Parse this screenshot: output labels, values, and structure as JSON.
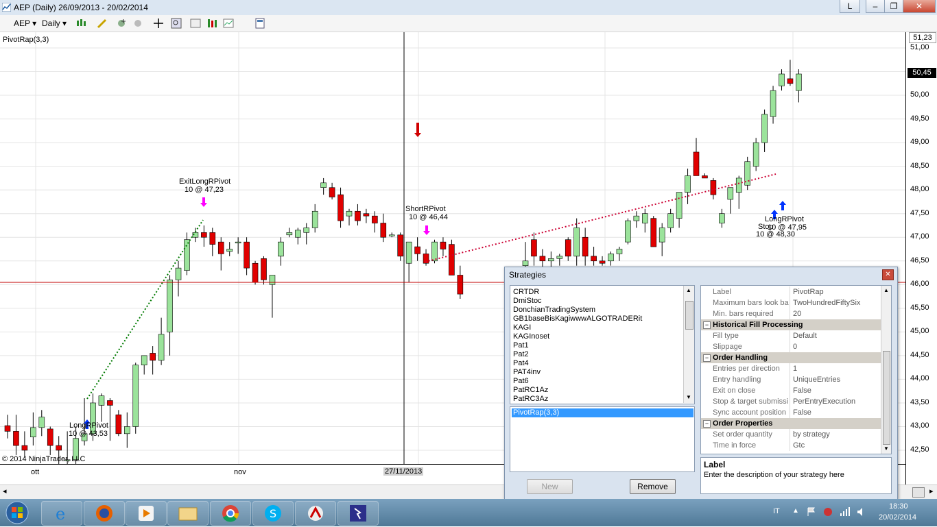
{
  "window": {
    "title": "AEP (Daily)  26/09/2013 - 20/02/2014",
    "buttons": [
      "L",
      "–",
      "❐",
      "✕"
    ]
  },
  "toolbar": {
    "instrument": "AEP",
    "period": "Daily"
  },
  "chart": {
    "indicator_label": "PivotRap(3,3)",
    "copyright": "© 2014 NinjaTrader, LLC",
    "current_price": "50,45",
    "top_label": "51,23",
    "price_ticks": [
      "51,00",
      "50,50",
      "50,00",
      "49,50",
      "49,00",
      "48,50",
      "48,00",
      "47,50",
      "47,00",
      "46,50",
      "46,00",
      "45,50",
      "45,00",
      "44,50",
      "44,00",
      "43,50",
      "43,00",
      "42,50"
    ],
    "time_ticks": [
      "ott",
      "nov",
      "27/11/2013"
    ],
    "annotations": {
      "exit_long": "ExitLongRPivot",
      "exit_long_val": "10 @ 47,23",
      "short": "ShortRPivot",
      "short_val": "10 @ 46,44",
      "long1": "LongRPivot",
      "long1_val": "10 @ 43,53",
      "long2": "LongRPivot",
      "stop": "Stop",
      "long2_val": "10 @ 47,95",
      "stop_val": "10 @ 48,30"
    },
    "candles": [
      {
        "o": 43.02,
        "h": 43.25,
        "l": 42.75,
        "c": 42.9
      },
      {
        "o": 42.9,
        "h": 43.25,
        "l": 42.4,
        "c": 42.6
      },
      {
        "o": 42.6,
        "h": 42.9,
        "l": 42.35,
        "c": 42.5
      },
      {
        "o": 42.78,
        "h": 43.3,
        "l": 42.6,
        "c": 42.98
      },
      {
        "o": 42.98,
        "h": 43.35,
        "l": 42.8,
        "c": 43.2
      },
      {
        "o": 42.95,
        "h": 43.0,
        "l": 42.4,
        "c": 42.6
      },
      {
        "o": 42.6,
        "h": 42.8,
        "l": 42.2,
        "c": 42.5
      },
      {
        "o": 42.3,
        "h": 42.9,
        "l": 42.2,
        "c": 42.3
      },
      {
        "o": 42.3,
        "h": 43.0,
        "l": 42.2,
        "c": 42.75
      },
      {
        "o": 42.7,
        "h": 43.6,
        "l": 42.6,
        "c": 42.85
      },
      {
        "o": 42.85,
        "h": 43.7,
        "l": 42.7,
        "c": 43.5
      },
      {
        "o": 43.45,
        "h": 43.7,
        "l": 43.1,
        "c": 43.65
      },
      {
        "o": 43.55,
        "h": 43.6,
        "l": 42.7,
        "c": 43.45
      },
      {
        "o": 43.25,
        "h": 43.35,
        "l": 42.8,
        "c": 42.85
      },
      {
        "o": 42.85,
        "h": 43.3,
        "l": 42.55,
        "c": 43.0
      },
      {
        "o": 43.0,
        "h": 44.35,
        "l": 42.85,
        "c": 44.3
      },
      {
        "o": 44.3,
        "h": 44.5,
        "l": 44.1,
        "c": 44.5
      },
      {
        "o": 44.55,
        "h": 44.7,
        "l": 44.1,
        "c": 44.4
      },
      {
        "o": 44.4,
        "h": 45.3,
        "l": 44.3,
        "c": 44.95
      },
      {
        "o": 45.0,
        "h": 46.2,
        "l": 44.5,
        "c": 46.1
      },
      {
        "o": 46.1,
        "h": 46.5,
        "l": 45.75,
        "c": 46.35
      },
      {
        "o": 46.3,
        "h": 47.1,
        "l": 46.2,
        "c": 46.95
      },
      {
        "o": 47.0,
        "h": 47.2,
        "l": 46.9,
        "c": 47.1
      },
      {
        "o": 47.1,
        "h": 47.25,
        "l": 46.8,
        "c": 47.0
      },
      {
        "o": 47.1,
        "h": 47.2,
        "l": 46.6,
        "c": 46.85
      },
      {
        "o": 46.9,
        "h": 47.0,
        "l": 46.3,
        "c": 46.65
      },
      {
        "o": 46.7,
        "h": 46.9,
        "l": 46.6,
        "c": 46.75
      },
      {
        "o": 46.9,
        "h": 47.0,
        "l": 46.65,
        "c": 46.9
      },
      {
        "o": 46.9,
        "h": 47.0,
        "l": 46.2,
        "c": 46.35
      },
      {
        "o": 46.45,
        "h": 46.5,
        "l": 46.0,
        "c": 46.05
      },
      {
        "o": 46.55,
        "h": 46.6,
        "l": 46.0,
        "c": 46.1
      },
      {
        "o": 46.0,
        "h": 46.2,
        "l": 45.3,
        "c": 46.2
      },
      {
        "o": 46.6,
        "h": 47.0,
        "l": 46.4,
        "c": 46.9
      },
      {
        "o": 47.05,
        "h": 47.2,
        "l": 47.0,
        "c": 47.1
      },
      {
        "o": 47.0,
        "h": 47.2,
        "l": 46.85,
        "c": 47.15
      },
      {
        "o": 47.1,
        "h": 47.3,
        "l": 46.85,
        "c": 47.2
      },
      {
        "o": 47.2,
        "h": 47.7,
        "l": 47.1,
        "c": 47.55
      },
      {
        "o": 48.05,
        "h": 48.25,
        "l": 47.9,
        "c": 48.15
      },
      {
        "o": 48.05,
        "h": 48.15,
        "l": 47.8,
        "c": 47.85
      },
      {
        "o": 47.9,
        "h": 48.05,
        "l": 47.2,
        "c": 47.35
      },
      {
        "o": 47.45,
        "h": 47.6,
        "l": 47.25,
        "c": 47.55
      },
      {
        "o": 47.55,
        "h": 47.7,
        "l": 47.25,
        "c": 47.35
      },
      {
        "o": 47.5,
        "h": 47.6,
        "l": 47.3,
        "c": 47.45
      },
      {
        "o": 47.45,
        "h": 47.55,
        "l": 47.1,
        "c": 47.3
      },
      {
        "o": 47.3,
        "h": 47.5,
        "l": 46.9,
        "c": 47.0
      },
      {
        "o": 47.05,
        "h": 47.1,
        "l": 47.0,
        "c": 47.05
      },
      {
        "o": 47.05,
        "h": 47.1,
        "l": 46.5,
        "c": 46.6
      },
      {
        "o": 46.45,
        "h": 46.6,
        "l": 46.05,
        "c": 46.9
      },
      {
        "o": 46.8,
        "h": 47.0,
        "l": 46.5,
        "c": 46.65
      },
      {
        "o": 46.65,
        "h": 46.75,
        "l": 46.4,
        "c": 46.45
      },
      {
        "o": 46.5,
        "h": 46.95,
        "l": 46.45,
        "c": 46.9
      },
      {
        "o": 46.9,
        "h": 47.0,
        "l": 46.6,
        "c": 46.75
      },
      {
        "o": 46.85,
        "h": 46.95,
        "l": 46.3,
        "c": 46.2
      },
      {
        "o": 46.2,
        "h": 46.4,
        "l": 45.7,
        "c": 45.8
      }
    ],
    "candles_right": [
      {
        "o": 46.4,
        "h": 46.9,
        "l": 46.2,
        "c": 46.5
      },
      {
        "o": 46.95,
        "h": 47.1,
        "l": 46.4,
        "c": 46.6
      },
      {
        "o": 46.6,
        "h": 46.75,
        "l": 46.3,
        "c": 46.5
      },
      {
        "o": 46.5,
        "h": 46.7,
        "l": 46.3,
        "c": 46.55
      },
      {
        "o": 46.55,
        "h": 46.65,
        "l": 46.4,
        "c": 46.6
      },
      {
        "o": 46.95,
        "h": 47.0,
        "l": 46.5,
        "c": 46.6
      },
      {
        "o": 46.6,
        "h": 47.4,
        "l": 46.4,
        "c": 47.2
      },
      {
        "o": 47.0,
        "h": 47.2,
        "l": 46.4,
        "c": 46.6
      },
      {
        "o": 46.6,
        "h": 46.8,
        "l": 46.4,
        "c": 46.5
      },
      {
        "o": 46.5,
        "h": 46.6,
        "l": 46.4,
        "c": 46.45
      },
      {
        "o": 46.5,
        "h": 46.7,
        "l": 46.4,
        "c": 46.65
      },
      {
        "o": 46.65,
        "h": 46.8,
        "l": 46.5,
        "c": 46.75
      },
      {
        "o": 46.9,
        "h": 47.4,
        "l": 46.85,
        "c": 47.35
      },
      {
        "o": 47.35,
        "h": 47.55,
        "l": 47.2,
        "c": 47.45
      },
      {
        "o": 47.3,
        "h": 47.6,
        "l": 47.1,
        "c": 47.5
      },
      {
        "o": 47.4,
        "h": 47.45,
        "l": 46.8,
        "c": 46.8
      },
      {
        "o": 46.9,
        "h": 47.3,
        "l": 46.6,
        "c": 47.2
      },
      {
        "o": 47.2,
        "h": 47.6,
        "l": 47.1,
        "c": 47.5
      },
      {
        "o": 47.4,
        "h": 47.95,
        "l": 47.2,
        "c": 47.95
      },
      {
        "o": 47.95,
        "h": 48.45,
        "l": 47.7,
        "c": 48.3
      },
      {
        "o": 48.8,
        "h": 49.1,
        "l": 48.3,
        "c": 48.3
      },
      {
        "o": 48.3,
        "h": 48.35,
        "l": 48.25,
        "c": 48.25
      },
      {
        "o": 48.2,
        "h": 48.25,
        "l": 47.8,
        "c": 47.9
      },
      {
        "o": 47.3,
        "h": 47.6,
        "l": 47.2,
        "c": 47.5
      },
      {
        "o": 47.8,
        "h": 48.05,
        "l": 47.5,
        "c": 48.05
      },
      {
        "o": 47.95,
        "h": 48.3,
        "l": 47.6,
        "c": 48.25
      },
      {
        "o": 48.1,
        "h": 48.7,
        "l": 48.0,
        "c": 48.6
      },
      {
        "o": 48.5,
        "h": 49.1,
        "l": 48.4,
        "c": 49.0
      },
      {
        "o": 49.0,
        "h": 49.7,
        "l": 48.8,
        "c": 49.6
      },
      {
        "o": 49.55,
        "h": 50.2,
        "l": 49.4,
        "c": 50.1
      },
      {
        "o": 50.2,
        "h": 50.55,
        "l": 50.1,
        "c": 50.45
      },
      {
        "o": 50.35,
        "h": 50.75,
        "l": 50.2,
        "c": 50.25
      },
      {
        "o": 50.1,
        "h": 50.55,
        "l": 49.85,
        "c": 50.45
      }
    ]
  },
  "dialog": {
    "title": "Strategies",
    "strategies": [
      "CRTDR",
      "DmiStoc",
      "DonchianTradingSystem",
      "GB1baseBisKagiwwwALGOTRADERit",
      "KAGI",
      "KAGInoset",
      "Pat1",
      "Pat2",
      "Pat4",
      "PAT4inv",
      "Pat6",
      "PatRC1Az",
      "PatRC3Az"
    ],
    "added": "PivotRap(3,3)",
    "new_label": "New",
    "remove_label": "Remove",
    "props": [
      {
        "n": "Label",
        "v": "PivotRap"
      },
      {
        "n": "Maximum bars look ba",
        "v": "TwoHundredFiftySix"
      },
      {
        "n": "Min. bars required",
        "v": "20"
      }
    ],
    "cat1": "Historical Fill Processing",
    "props1": [
      {
        "n": "Fill type",
        "v": "Default"
      },
      {
        "n": "Slippage",
        "v": "0"
      }
    ],
    "cat2": "Order Handling",
    "props2": [
      {
        "n": "Entries per direction",
        "v": "1"
      },
      {
        "n": "Entry handling",
        "v": "UniqueEntries"
      },
      {
        "n": "Exit on close",
        "v": "False"
      },
      {
        "n": "Stop & target submissi",
        "v": "PerEntryExecution"
      },
      {
        "n": "Sync account position",
        "v": "False"
      }
    ],
    "cat3": "Order Properties",
    "props3": [
      {
        "n": "Set order quantity",
        "v": "by strategy"
      },
      {
        "n": "Time in force",
        "v": "Gtc"
      }
    ],
    "desc_title": "Label",
    "desc_text": "Enter the description of your strategy here"
  },
  "taskbar": {
    "lang": "IT",
    "time": "18:30",
    "date": "20/02/2014"
  }
}
